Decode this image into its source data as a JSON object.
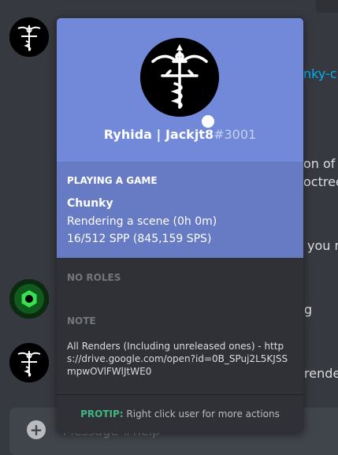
{
  "background": {
    "fragments": [
      "nky-c",
      "on of a",
      "octree",
      "you r",
      "g",
      "rende"
    ],
    "input_placeholder": "Message #help"
  },
  "profile": {
    "username": "Ryhida | Jackjt8",
    "discriminator": "#3001",
    "status_color": "#ffffff",
    "header_color": "#7289da"
  },
  "activity": {
    "heading": "PLAYING A GAME",
    "game": "Chunky",
    "details": "Rendering a scene (0h 0m)",
    "state": "16/512 SPP (845,159 SPS)"
  },
  "roles": {
    "heading": "NO ROLES"
  },
  "note": {
    "heading": "NOTE",
    "text": "All Renders (Including unreleased ones) - https://drive.google.com/open?id=0B_SPuj2L5KJSSmpwOVlFWlJtWE0"
  },
  "protip": {
    "label": "PROTIP:",
    "text": " Right click user for more actions"
  }
}
